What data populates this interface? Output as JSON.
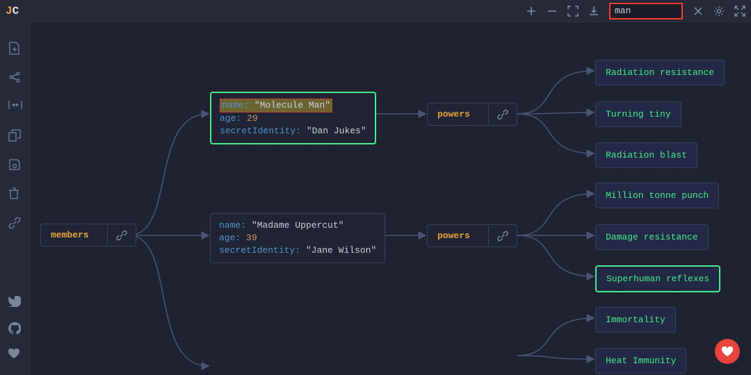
{
  "app": {
    "logo": {
      "j": "J",
      "c": "C"
    }
  },
  "toolbar": {
    "search_value": "man"
  },
  "graph": {
    "root": {
      "label": "members"
    },
    "member1": {
      "name_key": "name:",
      "name_val": "\"Molecule Man\"",
      "age_key": "age:",
      "age_val": "29",
      "id_key": "secretIdentity:",
      "id_val": "\"Dan Jukes\"",
      "powers_label": "powers",
      "powers": [
        "Radiation resistance",
        "Turning tiny",
        "Radiation blast"
      ]
    },
    "member2": {
      "name_key": "name:",
      "name_val": "\"Madame Uppercut\"",
      "age_key": "age:",
      "age_val": "39",
      "id_key": "secretIdentity:",
      "id_val": "\"Jane Wilson\"",
      "powers_label": "powers",
      "powers": [
        "Million tonne punch",
        "Damage resistance",
        "Superhuman reflexes"
      ]
    },
    "member3": {
      "powers": [
        "Immortality",
        "Heat Immunity"
      ]
    }
  }
}
